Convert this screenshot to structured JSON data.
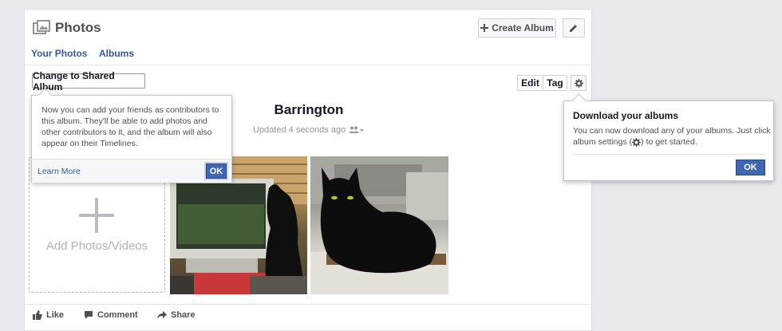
{
  "header": {
    "title": "Photos",
    "create_album_label": "Create Album"
  },
  "tabs": [
    {
      "label": "Your Photos"
    },
    {
      "label": "Albums"
    }
  ],
  "toolbar": {
    "shared_album_label": "Change to Shared Album",
    "edit_label": "Edit",
    "tag_label": "Tag"
  },
  "album": {
    "title": "Barrington",
    "updated": "Updated 4 seconds ago",
    "add_label": "Add Photos/Videos"
  },
  "actions": {
    "like": "Like",
    "comment": "Comment",
    "share": "Share"
  },
  "shared_tip": {
    "body": "Now you can add your friends as contributors to this album. They'll be able to add photos and other contributors to it, and the album will also appear on their Timelines.",
    "learn_more": "Learn More",
    "ok": "OK"
  },
  "download_tip": {
    "title": "Download your albums",
    "body_before": "You can now download any of your albums. Just click album settings (",
    "body_after": ") to get started.",
    "ok": "OK"
  },
  "colors": {
    "link": "#365899",
    "button_blue": "#4267b2"
  }
}
